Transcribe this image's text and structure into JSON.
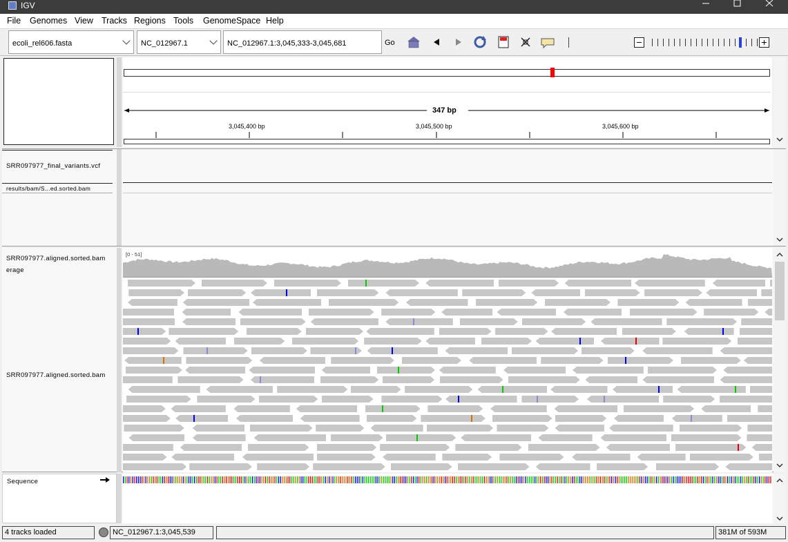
{
  "window": {
    "title": "IGV"
  },
  "menu": [
    "File",
    "Genomes",
    "View",
    "Tracks",
    "Regions",
    "Tools",
    "GenomeSpace",
    "Help"
  ],
  "toolbar": {
    "genome": "ecoli_rel606.fasta",
    "chromosome": "NC_012967.1",
    "locus": "NC_012967.1:3,045,333-3,045,681",
    "go_label": "Go",
    "icons": [
      "home-icon",
      "back-icon",
      "forward-icon",
      "refresh-icon",
      "region-icon",
      "resize-icon",
      "popup-icon"
    ],
    "zoom_level": 10,
    "zoom_max": 12
  },
  "ruler": {
    "span_label": "347 bp",
    "ticks": [
      "3,045,400 bp",
      "3,045,500 bp",
      "3,045,600 bp"
    ],
    "current_region_marker": 0.66
  },
  "tracks": {
    "vcf": "SRR097977_final_variants.vcf",
    "bam_results": "results/bam/S...ed.sorted.bam",
    "coverage_line1": "SRR097977.aligned.sorted.bam",
    "coverage_line2": "erage",
    "coverage_range": "[0 - 51]",
    "alignment": "SRR097977.aligned.sorted.bam",
    "sequence": "Sequence"
  },
  "colors": {
    "read": "#c7c7c7",
    "A": "#00cc00",
    "C": "#0000e6",
    "G": "#d17100",
    "T": "#e00000",
    "marker": "#ff0000"
  },
  "status": {
    "message": "4 tracks loaded",
    "position": "NC_012967.1:3,045,539",
    "memory": "381M of 593M"
  }
}
